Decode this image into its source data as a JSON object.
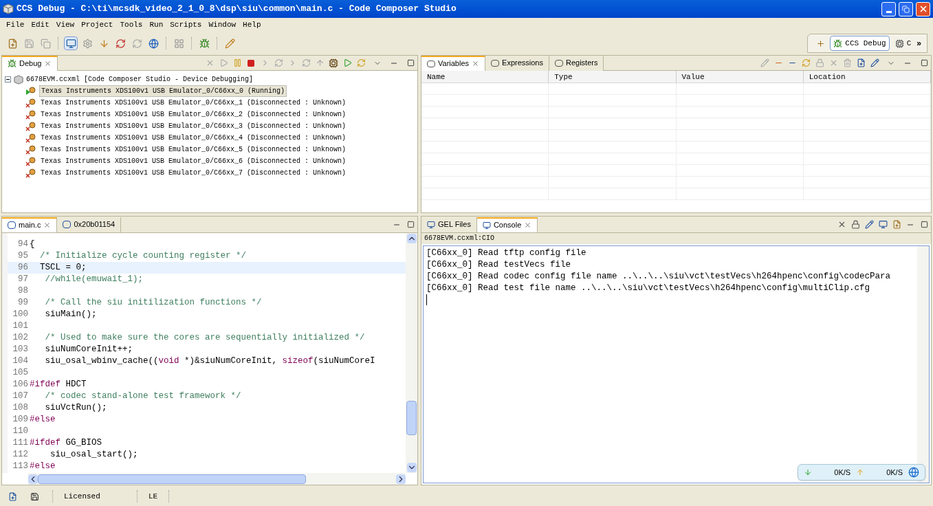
{
  "window": {
    "title": "CCS Debug - C:\\ti\\mcsdk_video_2_1_0_8\\dsp\\siu\\common\\main.c - Code Composer Studio"
  },
  "menu": [
    "File",
    "Edit",
    "View",
    "Project",
    "Tools",
    "Run",
    "Scripts",
    "Window",
    "Help"
  ],
  "perspectives": [
    {
      "label": "CCS Debug",
      "selected": true
    },
    {
      "label": "C",
      "selected": false
    }
  ],
  "perspective_more": "»",
  "debug_panel": {
    "tabs": [
      {
        "label": "Debug",
        "selected": true
      }
    ],
    "tree": {
      "label": "6678EVM.ccxml [Code Composer Studio - Device Debugging]",
      "expanded": true,
      "children": [
        {
          "label": "Texas Instruments XDS100v1 USB Emulator_0/C66xx_0 (Running)",
          "kind": "running",
          "selected": true
        },
        {
          "label": "Texas Instruments XDS100v1 USB Emulator_0/C66xx_1 (Disconnected : Unknown)",
          "kind": "disconnected",
          "selected": false
        },
        {
          "label": "Texas Instruments XDS100v1 USB Emulator_0/C66xx_2 (Disconnected : Unknown)",
          "kind": "disconnected",
          "selected": false
        },
        {
          "label": "Texas Instruments XDS100v1 USB Emulator_0/C66xx_3 (Disconnected : Unknown)",
          "kind": "disconnected",
          "selected": false
        },
        {
          "label": "Texas Instruments XDS100v1 USB Emulator_0/C66xx_4 (Disconnected : Unknown)",
          "kind": "disconnected",
          "selected": false
        },
        {
          "label": "Texas Instruments XDS100v1 USB Emulator_0/C66xx_5 (Disconnected : Unknown)",
          "kind": "disconnected",
          "selected": false
        },
        {
          "label": "Texas Instruments XDS100v1 USB Emulator_0/C66xx_6 (Disconnected : Unknown)",
          "kind": "disconnected",
          "selected": false
        },
        {
          "label": "Texas Instruments XDS100v1 USB Emulator_0/C66xx_7 (Disconnected : Unknown)",
          "kind": "disconnected",
          "selected": false
        }
      ]
    }
  },
  "variables_panel": {
    "tabs": [
      {
        "label": "Variables",
        "selected": true
      },
      {
        "label": "Expressions",
        "selected": false
      },
      {
        "label": "Registers",
        "selected": false
      }
    ],
    "table": {
      "columns": [
        "Name",
        "Type",
        "Value",
        "Location"
      ]
    }
  },
  "editor": {
    "tabs": [
      {
        "label": "main.c",
        "selected": true
      },
      {
        "label": "0x20b01154",
        "selected": false
      }
    ],
    "lines": [
      {
        "num": "94",
        "current": false,
        "tokens": [
          {
            "kind": "plain",
            "text": "{"
          }
        ]
      },
      {
        "num": "95",
        "current": false,
        "tokens": [
          {
            "kind": "comment",
            "text": "  /* Initialize cycle counting register */"
          }
        ]
      },
      {
        "num": "96",
        "current": true,
        "tokens": [
          {
            "kind": "plain",
            "text": "  TSCL = 0;"
          }
        ]
      },
      {
        "num": "97",
        "current": false,
        "tokens": [
          {
            "kind": "comment",
            "text": "   //while(emuwait_1);"
          }
        ]
      },
      {
        "num": "98",
        "current": false
      },
      {
        "num": "99",
        "current": false,
        "tokens": [
          {
            "kind": "comment",
            "text": "   /* Call the siu initilization functions */"
          }
        ]
      },
      {
        "num": "100",
        "current": false,
        "tokens": [
          {
            "kind": "plain",
            "text": "   siuMain();"
          }
        ]
      },
      {
        "num": "101",
        "current": false
      },
      {
        "num": "102",
        "current": false,
        "tokens": [
          {
            "kind": "comment",
            "text": "   /* Used to make sure the cores are sequentially initialized */"
          }
        ]
      },
      {
        "num": "103",
        "current": false,
        "tokens": [
          {
            "kind": "plain",
            "text": "   siuNumCoreInit++;"
          }
        ]
      },
      {
        "num": "104",
        "current": false,
        "tokens": [
          {
            "kind": "plain",
            "text": "   siu_osal_wbinv_cache(("
          },
          {
            "kind": "keyword",
            "text": "void"
          },
          {
            "kind": "plain",
            "text": " *)&siuNumCoreInit, "
          },
          {
            "kind": "keyword",
            "text": "sizeof"
          },
          {
            "kind": "plain",
            "text": "(siuNumCoreI"
          }
        ]
      },
      {
        "num": "105",
        "current": false
      },
      {
        "num": "106",
        "current": false,
        "tokens": [
          {
            "kind": "keyword",
            "text": "#ifdef"
          },
          {
            "kind": "plain",
            "text": " HDCT"
          }
        ]
      },
      {
        "num": "107",
        "current": false,
        "tokens": [
          {
            "kind": "comment",
            "text": "   /* codec stand-alone test framework */"
          }
        ]
      },
      {
        "num": "108",
        "current": false,
        "tokens": [
          {
            "kind": "plain",
            "text": "   siuVctRun();"
          }
        ]
      },
      {
        "num": "109",
        "current": false,
        "tokens": [
          {
            "kind": "keyword",
            "text": "#else"
          }
        ]
      },
      {
        "num": "110",
        "current": false
      },
      {
        "num": "111",
        "current": false,
        "tokens": [
          {
            "kind": "keyword",
            "text": "#ifdef"
          },
          {
            "kind": "plain",
            "text": " GG_BIOS"
          }
        ]
      },
      {
        "num": "112",
        "current": false,
        "tokens": [
          {
            "kind": "plain",
            "text": "    siu_osal_start();"
          }
        ]
      },
      {
        "num": "113",
        "current": false,
        "tokens": [
          {
            "kind": "keyword",
            "text": "#else"
          }
        ]
      }
    ]
  },
  "console_panel": {
    "tabs": [
      {
        "label": "GEL Files",
        "selected": false
      },
      {
        "label": "Console",
        "selected": true
      }
    ],
    "source": "6678EVM.ccxml:CIO",
    "lines": [
      "[C66xx_0] Read tftp config file",
      "[C66xx_0] Read testVecs file",
      "[C66xx_0] Read codec config file name ..\\..\\..\\siu\\vct\\testVecs\\h264hpenc\\config\\codecPara",
      "[C66xx_0] Read test file name ..\\..\\..\\siu\\vct\\testVecs\\h264hpenc\\config\\multiClip.cfg"
    ]
  },
  "network_widget": {
    "download": "0K/S",
    "upload": "0K/S"
  },
  "status_bar": {
    "license": "Licensed",
    "endian": "LE"
  }
}
